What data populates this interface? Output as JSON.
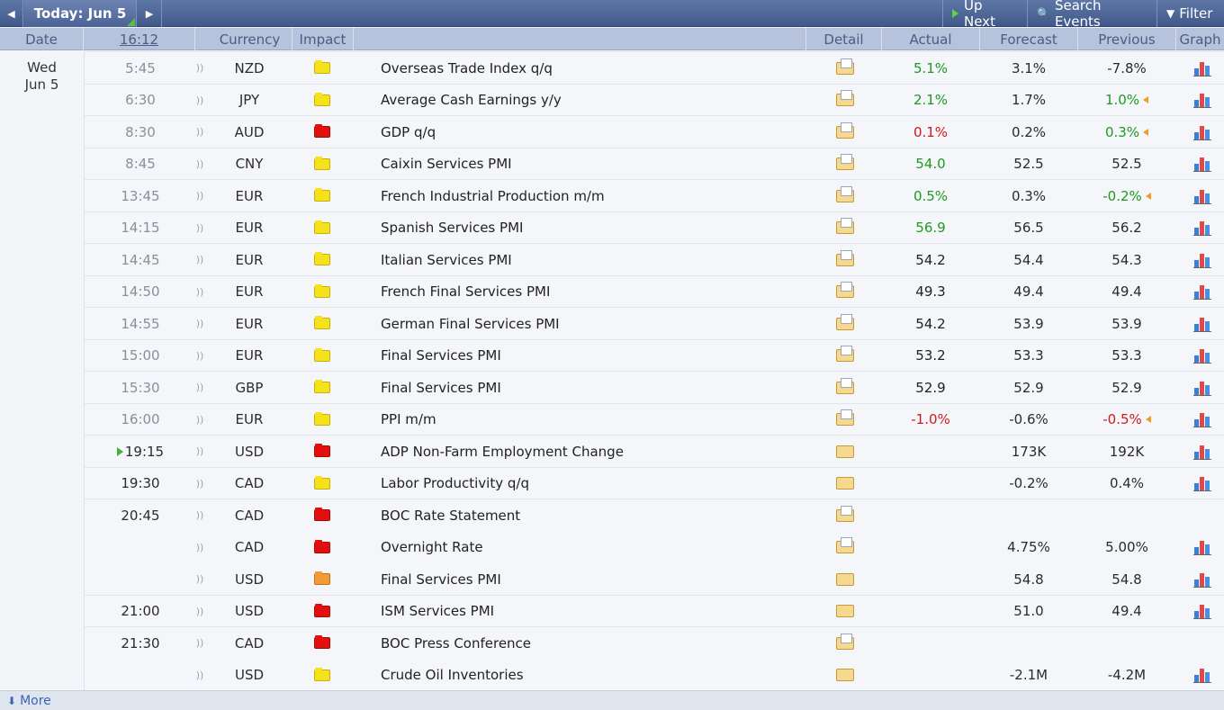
{
  "toolbar": {
    "prev_glyph": "◀",
    "today_label": "Today: Jun 5",
    "next_glyph": "▶",
    "up_next_label": "Up Next",
    "search_label": "Search Events",
    "filter_label": "Filter",
    "search_glyph": "🔍",
    "filter_glyph": "▼"
  },
  "columns": {
    "date": "Date",
    "clock": "16:12",
    "currency": "Currency",
    "impact": "Impact",
    "detail": "Detail",
    "actual": "Actual",
    "forecast": "Forecast",
    "previous": "Previous",
    "graph": "Graph"
  },
  "day": {
    "weekday": "Wed",
    "date": "Jun 5"
  },
  "events": [
    {
      "time": "5:45",
      "currency": "NZD",
      "impact": "yellow",
      "event": "Overseas Trade Index q/q",
      "actual": "5.1%",
      "actual_color": "green",
      "forecast": "3.1%",
      "previous": "-7.8%",
      "previous_color": "",
      "revised": false,
      "detail_doc": true,
      "graph": true
    },
    {
      "time": "6:30",
      "currency": "JPY",
      "impact": "yellow",
      "event": "Average Cash Earnings y/y",
      "actual": "2.1%",
      "actual_color": "green",
      "forecast": "1.7%",
      "previous": "1.0%",
      "previous_color": "green",
      "revised": true,
      "detail_doc": true,
      "graph": true
    },
    {
      "time": "8:30",
      "currency": "AUD",
      "impact": "red",
      "event": "GDP q/q",
      "actual": "0.1%",
      "actual_color": "red",
      "forecast": "0.2%",
      "previous": "0.3%",
      "previous_color": "green",
      "revised": true,
      "detail_doc": true,
      "graph": true
    },
    {
      "time": "8:45",
      "currency": "CNY",
      "impact": "yellow",
      "event": "Caixin Services PMI",
      "actual": "54.0",
      "actual_color": "green",
      "forecast": "52.5",
      "previous": "52.5",
      "previous_color": "",
      "revised": false,
      "detail_doc": true,
      "graph": true
    },
    {
      "time": "13:45",
      "currency": "EUR",
      "impact": "yellow",
      "event": "French Industrial Production m/m",
      "actual": "0.5%",
      "actual_color": "green",
      "forecast": "0.3%",
      "previous": "-0.2%",
      "previous_color": "green",
      "revised": true,
      "detail_doc": true,
      "graph": true
    },
    {
      "time": "14:15",
      "currency": "EUR",
      "impact": "yellow",
      "event": "Spanish Services PMI",
      "actual": "56.9",
      "actual_color": "green",
      "forecast": "56.5",
      "previous": "56.2",
      "previous_color": "",
      "revised": false,
      "detail_doc": true,
      "graph": true
    },
    {
      "time": "14:45",
      "currency": "EUR",
      "impact": "yellow",
      "event": "Italian Services PMI",
      "actual": "54.2",
      "actual_color": "",
      "forecast": "54.4",
      "previous": "54.3",
      "previous_color": "",
      "revised": false,
      "detail_doc": true,
      "graph": true
    },
    {
      "time": "14:50",
      "currency": "EUR",
      "impact": "yellow",
      "event": "French Final Services PMI",
      "actual": "49.3",
      "actual_color": "",
      "forecast": "49.4",
      "previous": "49.4",
      "previous_color": "",
      "revised": false,
      "detail_doc": true,
      "graph": true
    },
    {
      "time": "14:55",
      "currency": "EUR",
      "impact": "yellow",
      "event": "German Final Services PMI",
      "actual": "54.2",
      "actual_color": "",
      "forecast": "53.9",
      "previous": "53.9",
      "previous_color": "",
      "revised": false,
      "detail_doc": true,
      "graph": true
    },
    {
      "time": "15:00",
      "currency": "EUR",
      "impact": "yellow",
      "event": "Final Services PMI",
      "actual": "53.2",
      "actual_color": "",
      "forecast": "53.3",
      "previous": "53.3",
      "previous_color": "",
      "revised": false,
      "detail_doc": true,
      "graph": true
    },
    {
      "time": "15:30",
      "currency": "GBP",
      "impact": "yellow",
      "event": "Final Services PMI",
      "actual": "52.9",
      "actual_color": "",
      "forecast": "52.9",
      "previous": "52.9",
      "previous_color": "",
      "revised": false,
      "detail_doc": true,
      "graph": true
    },
    {
      "time": "16:00",
      "currency": "EUR",
      "impact": "yellow",
      "event": "PPI m/m",
      "actual": "-1.0%",
      "actual_color": "red",
      "forecast": "-0.6%",
      "previous": "-0.5%",
      "previous_color": "red",
      "revised": true,
      "detail_doc": true,
      "graph": true
    },
    {
      "time": "19:15",
      "currency": "USD",
      "impact": "red",
      "event": "ADP Non-Farm Employment Change",
      "actual": "",
      "actual_color": "",
      "forecast": "173K",
      "previous": "192K",
      "previous_color": "",
      "revised": false,
      "detail_doc": false,
      "graph": true,
      "upcoming": true
    },
    {
      "time": "19:30",
      "currency": "CAD",
      "impact": "yellow",
      "event": "Labor Productivity q/q",
      "actual": "",
      "actual_color": "",
      "forecast": "-0.2%",
      "previous": "0.4%",
      "previous_color": "",
      "revised": false,
      "detail_doc": false,
      "graph": true
    },
    {
      "time": "20:45",
      "currency": "CAD",
      "impact": "red",
      "event": "BOC Rate Statement",
      "actual": "",
      "actual_color": "",
      "forecast": "",
      "previous": "",
      "previous_color": "",
      "revised": false,
      "detail_doc": true,
      "graph": false
    },
    {
      "time": "",
      "currency": "CAD",
      "impact": "red",
      "event": "Overnight Rate",
      "actual": "",
      "actual_color": "",
      "forecast": "4.75%",
      "previous": "5.00%",
      "previous_color": "",
      "revised": false,
      "detail_doc": true,
      "graph": true
    },
    {
      "time": "",
      "currency": "USD",
      "impact": "orange",
      "event": "Final Services PMI",
      "actual": "",
      "actual_color": "",
      "forecast": "54.8",
      "previous": "54.8",
      "previous_color": "",
      "revised": false,
      "detail_doc": false,
      "graph": true
    },
    {
      "time": "21:00",
      "currency": "USD",
      "impact": "red",
      "event": "ISM Services PMI",
      "actual": "",
      "actual_color": "",
      "forecast": "51.0",
      "previous": "49.4",
      "previous_color": "",
      "revised": false,
      "detail_doc": false,
      "graph": true
    },
    {
      "time": "21:30",
      "currency": "CAD",
      "impact": "red",
      "event": "BOC Press Conference",
      "actual": "",
      "actual_color": "",
      "forecast": "",
      "previous": "",
      "previous_color": "",
      "revised": false,
      "detail_doc": true,
      "graph": false
    },
    {
      "time": "",
      "currency": "USD",
      "impact": "yellow",
      "event": "Crude Oil Inventories",
      "actual": "",
      "actual_color": "",
      "forecast": "-2.1M",
      "previous": "-4.2M",
      "previous_color": "",
      "revised": false,
      "detail_doc": false,
      "graph": true
    }
  ],
  "footer": {
    "more_label": "More"
  },
  "colors": {
    "green": "#1f9a1f",
    "red": "#d01b1b",
    "header_bg": "#b7c3dc",
    "toolbar_bg": "#4a6296"
  }
}
